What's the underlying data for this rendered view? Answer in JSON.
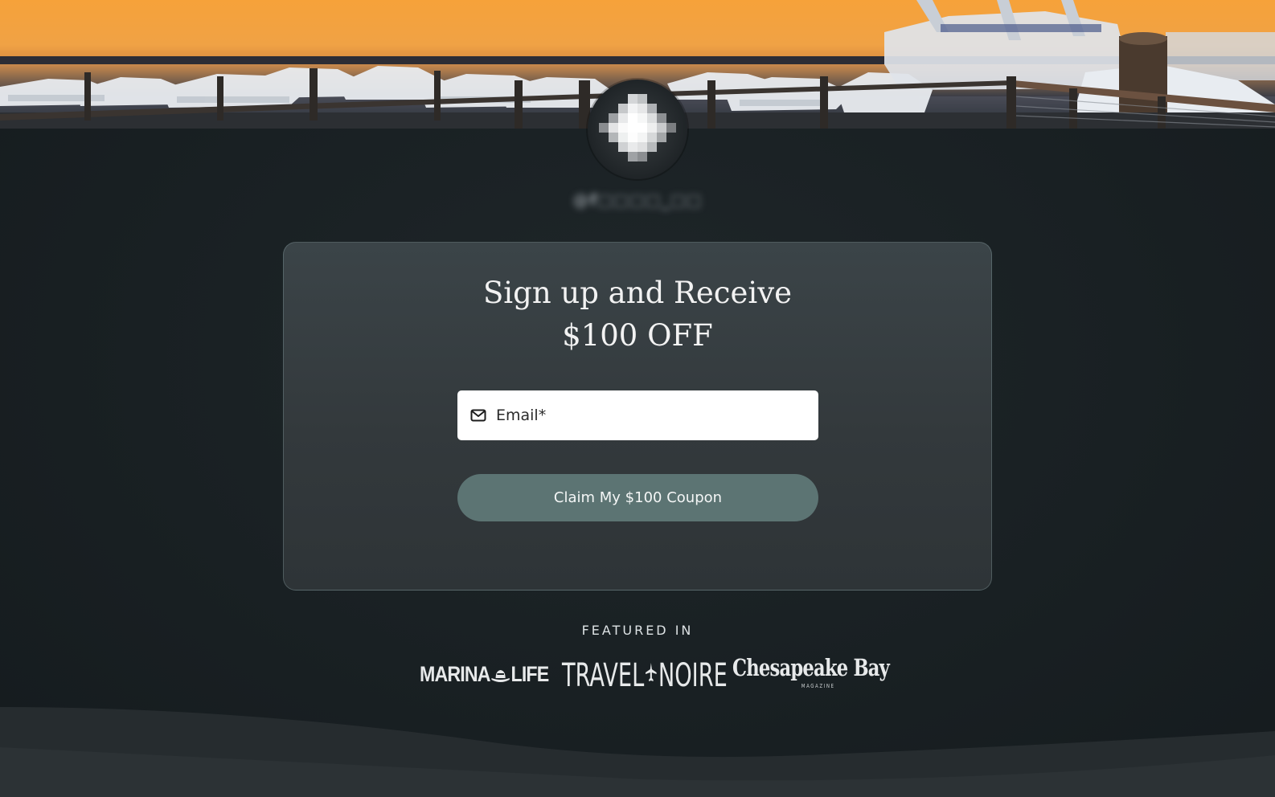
{
  "profile": {
    "handle": "@f□□□□_□□"
  },
  "signup": {
    "title_line1": "Sign up and Receive",
    "title_line2": "$100 OFF",
    "email_placeholder": "Email*",
    "button_label": "Claim My $100 Coupon",
    "button_color": "#5c7473"
  },
  "featured": {
    "label": "FEATURED IN",
    "logos": {
      "marina_left": "MARINA",
      "marina_right": "LIFE",
      "travel_left": "TRAVEL",
      "travel_right": "NOIRE",
      "chesapeake": "Chesapeake Bay",
      "chesapeake_sub": "MAGAZINE"
    }
  },
  "icons": {
    "email_field": "mail-icon",
    "marina_logo": "hat-icon",
    "travel_logo": "airplane-icon"
  },
  "theme": {
    "background": "#192023",
    "card": "#353c3f",
    "sunset_top": "#f2a03a"
  }
}
